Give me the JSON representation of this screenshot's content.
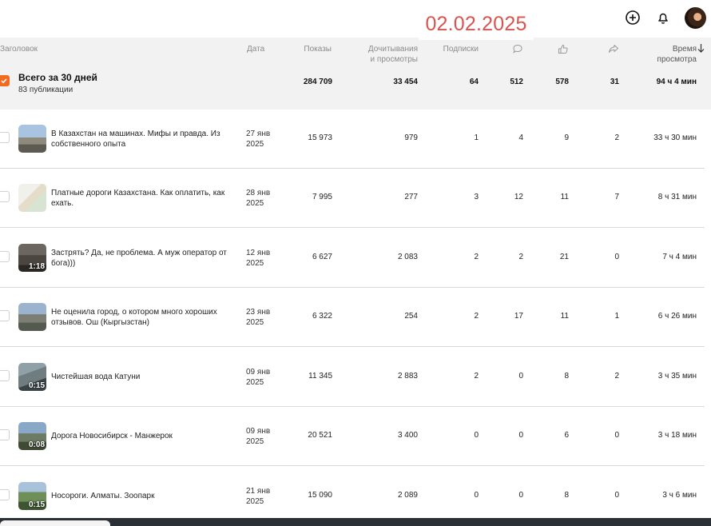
{
  "overlay_date": "02.02.2025",
  "header": {
    "icons": [
      "add-icon",
      "bell-icon",
      "avatar"
    ]
  },
  "columns": {
    "title": "Заголовок",
    "date": "Дата",
    "views": "Показы",
    "reads_line1": "Дочитывания",
    "reads_line2": "и просмотры",
    "subs": "Подписки",
    "comments_icon": "comment-icon",
    "likes_icon": "like-icon",
    "shares_icon": "share-icon",
    "time_line1": "Время",
    "time_line2": "просмотра"
  },
  "summary": {
    "title": "Всего за 30 дней",
    "subtitle": "83 публикации",
    "views": "284 709",
    "reads": "33 454",
    "subs": "64",
    "comments": "512",
    "likes": "578",
    "shares": "31",
    "time": "94 ч 4 мин"
  },
  "rows": [
    {
      "title": "В Казахстан на машинах. Мифы и правда. Из собственного опыта",
      "date1": "27 янв",
      "date2": "2025",
      "views": "15 973",
      "reads": "979",
      "subs": "1",
      "comments": "4",
      "likes": "9",
      "shares": "2",
      "time": "33 ч 30 мин",
      "duration": ""
    },
    {
      "title": "Платные дороги Казахстана. Как оплатить, как ехать.",
      "date1": "28 янв",
      "date2": "2025",
      "views": "7 995",
      "reads": "277",
      "subs": "3",
      "comments": "12",
      "likes": "11",
      "shares": "7",
      "time": "8 ч 31 мин",
      "duration": ""
    },
    {
      "title": "Застрять? Да, не проблема. А муж оператор от бога)))",
      "date1": "12 янв",
      "date2": "2025",
      "views": "6 627",
      "reads": "2 083",
      "subs": "2",
      "comments": "2",
      "likes": "21",
      "shares": "0",
      "time": "7 ч 4 мин",
      "duration": "1:18"
    },
    {
      "title": "Не оценила город, о котором много хороших отзывов. Ош (Кыргызстан)",
      "date1": "23 янв",
      "date2": "2025",
      "views": "6 322",
      "reads": "254",
      "subs": "2",
      "comments": "17",
      "likes": "11",
      "shares": "1",
      "time": "6 ч 26 мин",
      "duration": ""
    },
    {
      "title": "Чистейшая вода Катуни",
      "date1": "09 янв",
      "date2": "2025",
      "views": "11 345",
      "reads": "2 883",
      "subs": "2",
      "comments": "0",
      "likes": "8",
      "shares": "2",
      "time": "3 ч 35 мин",
      "duration": "0:15"
    },
    {
      "title": "Дорога Новосибирск - Манжерок",
      "date1": "09 янв",
      "date2": "2025",
      "views": "20 521",
      "reads": "3 400",
      "subs": "0",
      "comments": "0",
      "likes": "6",
      "shares": "0",
      "time": "3 ч 18 мин",
      "duration": "0:08"
    },
    {
      "title": "Носороги. Алматы. Зоопарк",
      "date1": "21 янв",
      "date2": "2025",
      "views": "15 090",
      "reads": "2 089",
      "subs": "0",
      "comments": "0",
      "likes": "8",
      "shares": "0",
      "time": "3 ч 6 мин",
      "duration": "0:15"
    }
  ],
  "colors": {
    "accent": "#f26b21",
    "overlay": "#d9534f"
  }
}
